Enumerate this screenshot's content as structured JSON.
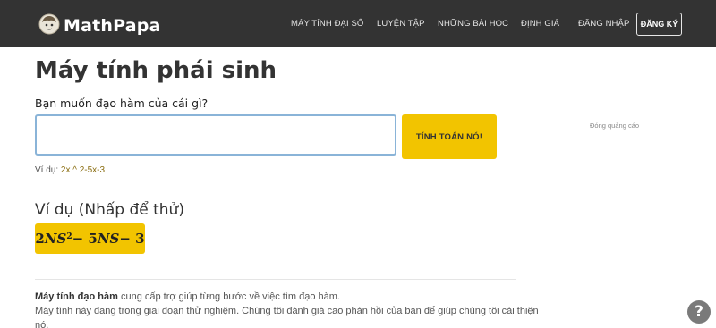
{
  "brand": {
    "name": "MathPapa",
    "logo_icon": "mathpapa-logo-icon"
  },
  "nav": {
    "items": [
      {
        "label": "MÁY TÍNH ĐẠI SỐ"
      },
      {
        "label": "LUYỆN TẬP"
      },
      {
        "label": "NHỮNG BÀI HỌC"
      },
      {
        "label": "ĐỊNH GIÁ"
      },
      {
        "label": "ĐĂNG NHẬP"
      }
    ],
    "signup_label": "ĐĂNG KÝ"
  },
  "main": {
    "title": "Máy tính phái sinh",
    "question": "Bạn muốn đạo hàm của cái gì?",
    "input": {
      "value": "",
      "placeholder": ""
    },
    "calculate_label": "TÍNH TOÁN NÓ!",
    "example_prefix": "Ví dụ:",
    "example_link": "2x ^ 2-5x-3",
    "examples_heading": "Ví dụ (Nhấp để thử)",
    "example_expression": {
      "coef1": "2",
      "var1": "NS",
      "exp1": "2",
      "op1": " − 5",
      "var2": "NS",
      "op2": " − 3"
    },
    "description": {
      "bold": "Máy tính đạo hàm",
      "line1_rest": " cung cấp trợ giúp từng bước về việc tìm đạo hàm.",
      "line2": "Máy tính này đang trong giai đoạn thử nghiệm. Chúng tôi đánh giá cao phản hồi của bạn để giúp chúng tôi cải thiện",
      "line3": "nó."
    }
  },
  "ad_label": "Đóng quảng cáo",
  "help_label": "?",
  "colors": {
    "navbar": "#333333",
    "accent": "#f2c400",
    "link": "#8a6d10",
    "input_border": "#8ab4d8"
  }
}
